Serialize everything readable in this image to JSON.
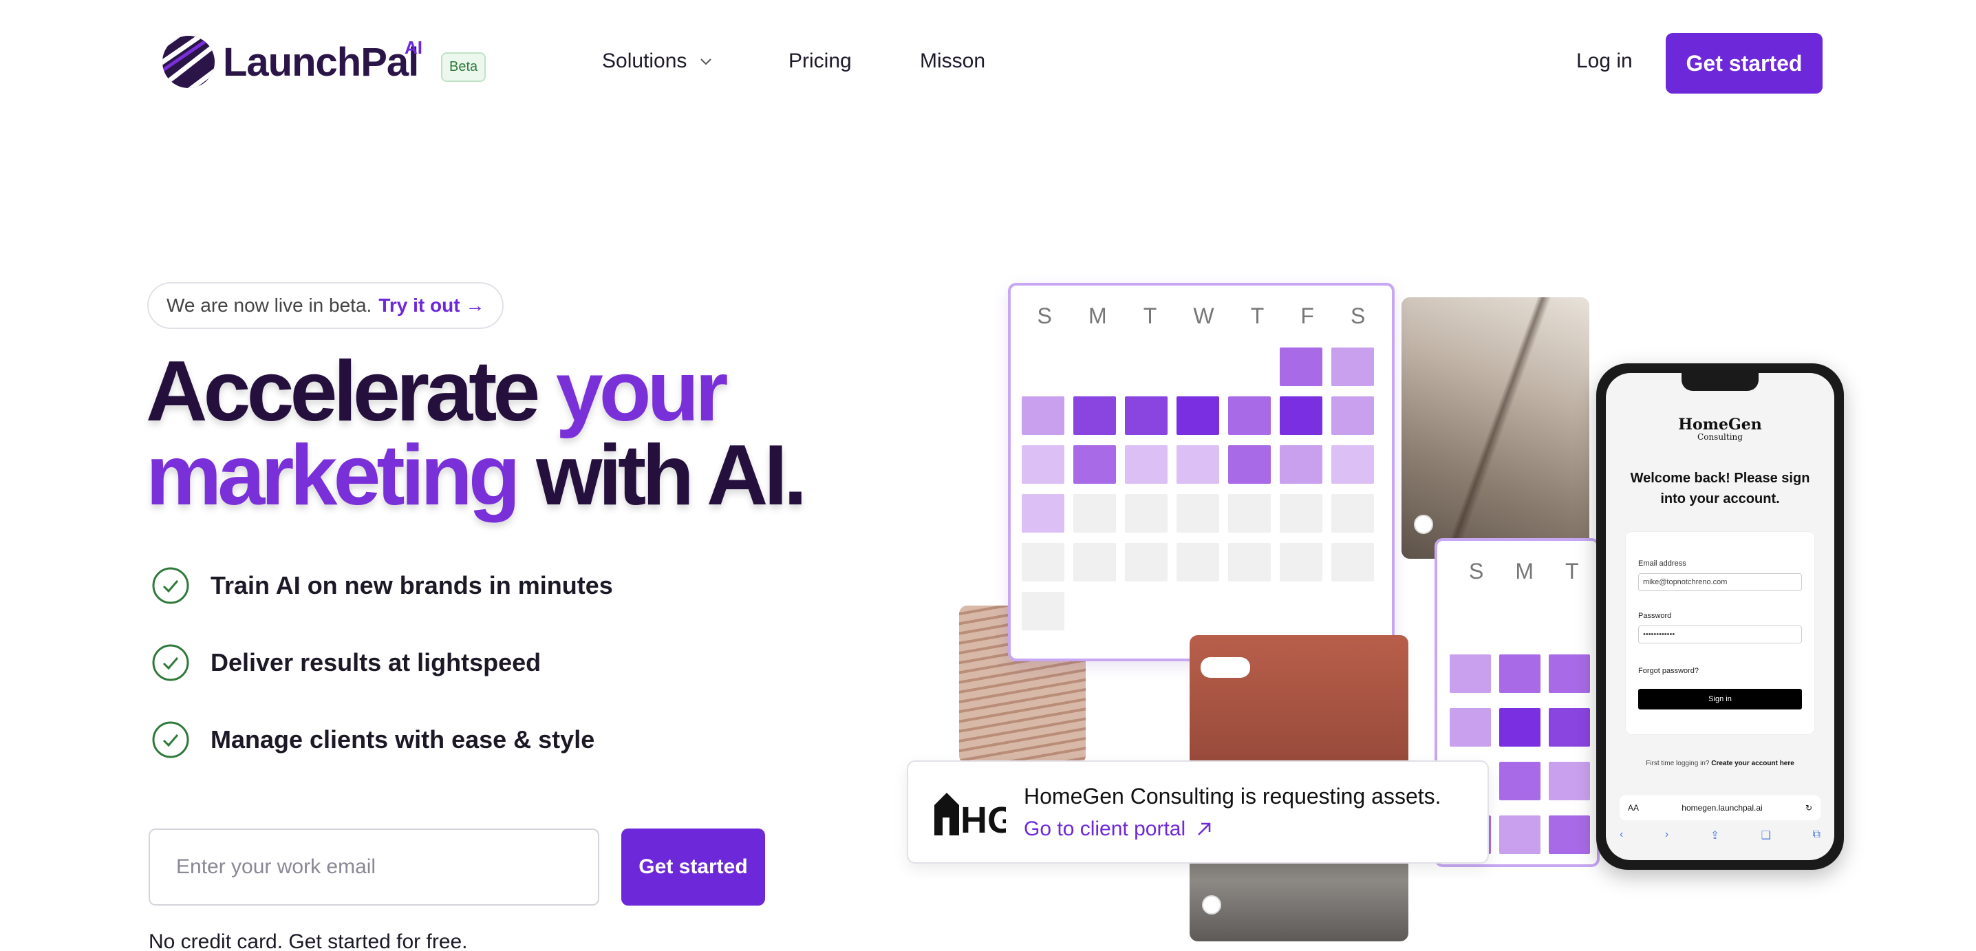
{
  "brand": {
    "name": "LaunchPal",
    "ai_tag": "AI",
    "badge": "Beta",
    "accent": "#6d28d9"
  },
  "nav": {
    "solutions": "Solutions",
    "pricing": "Pricing",
    "mission": "Misson",
    "login": "Log in",
    "cta": "Get started"
  },
  "hero": {
    "pill_text": "We are now live in beta.",
    "pill_link": "Try it out →",
    "headline": {
      "w1": "Accelerate",
      "w2": "your",
      "w3": "marketing",
      "w4": "with AI."
    },
    "features": [
      "Train AI on new brands in minutes",
      "Deliver results at lightspeed",
      "Manage clients with ease & style"
    ],
    "email_placeholder": "Enter your work email",
    "cta": "Get started",
    "note": "No credit card. Get started for free."
  },
  "calendar": {
    "days": [
      "S",
      "M",
      "T",
      "W",
      "T",
      "F",
      "S"
    ],
    "days_short": [
      "S",
      "M",
      "T"
    ]
  },
  "notification": {
    "logo_text": "HG",
    "title": "HomeGen Consulting is requesting assets.",
    "link": "Go to client portal"
  },
  "phone": {
    "logo": "HomeGen",
    "logo_sub": "Consulting",
    "welcome": "Welcome back! Please sign into your account.",
    "email_label": "Email address",
    "email_value": "mike@topnotchreno.com",
    "password_label": "Password",
    "password_value": "••••••••••••",
    "forgot": "Forgot password?",
    "signin": "Sign in",
    "first_time": "First time logging in?",
    "create": "Create your account here",
    "aa": "AA",
    "url": "homegen.launchpal.ai"
  }
}
